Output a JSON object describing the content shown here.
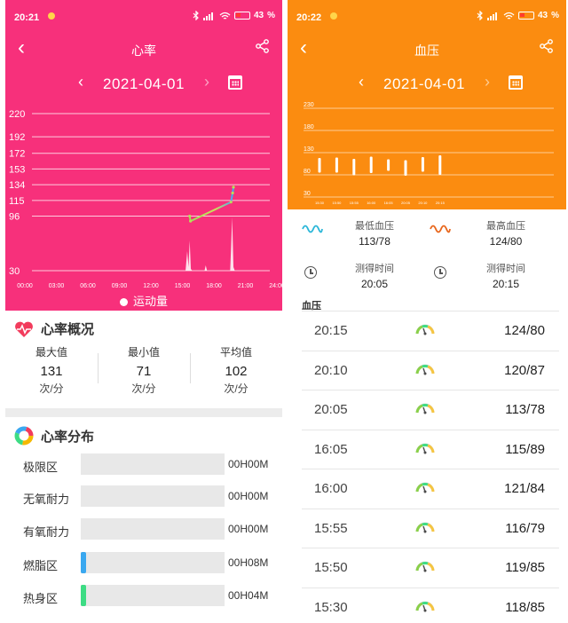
{
  "left": {
    "status": {
      "time": "20:21",
      "battery": "43"
    },
    "header": {
      "title": "心率",
      "date": "2021-04-01"
    },
    "colors": {
      "accent": "#f7307b"
    },
    "chart_data": {
      "type": "area",
      "y_ticks": [
        "220",
        "192",
        "172",
        "153",
        "134",
        "115",
        "96",
        "30"
      ],
      "x_ticks": [
        "00:00",
        "03:00",
        "06:00",
        "09:00",
        "12:00",
        "15:00",
        "18:00",
        "21:00",
        "24:00"
      ],
      "ylim": [
        30,
        220
      ],
      "legend": "运动量",
      "heart_rate_line": [
        {
          "x": "15:55",
          "y": 96
        },
        {
          "x": "16:00",
          "y": 90
        },
        {
          "x": "20:05",
          "y": 113
        },
        {
          "x": "20:15",
          "y": 124
        },
        {
          "x": "20:20",
          "y": 131
        }
      ]
    },
    "overview": {
      "title": "心率概况",
      "stats": [
        {
          "label": "最大值",
          "value": "131",
          "unit": "次/分"
        },
        {
          "label": "最小值",
          "value": "71",
          "unit": "次/分"
        },
        {
          "label": "平均值",
          "value": "102",
          "unit": "次/分"
        }
      ]
    },
    "zones": {
      "title": "心率分布",
      "items": [
        {
          "label": "极限区",
          "time": "00H00M",
          "color": ""
        },
        {
          "label": "无氧耐力",
          "time": "00H00M",
          "color": ""
        },
        {
          "label": "有氧耐力",
          "time": "00H00M",
          "color": ""
        },
        {
          "label": "燃脂区",
          "time": "00H08M",
          "color": "#3aa8f0"
        },
        {
          "label": "热身区",
          "time": "00H04M",
          "color": "#3ddc84"
        }
      ]
    }
  },
  "right": {
    "status": {
      "time": "20:22",
      "battery": "43"
    },
    "header": {
      "title": "血压",
      "date": "2021-04-01"
    },
    "colors": {
      "accent": "#fb8c10"
    },
    "chart_data": {
      "type": "bar",
      "y_ticks": [
        "230",
        "180",
        "130",
        "80",
        "30"
      ],
      "ylim": [
        30,
        230
      ],
      "categories": [
        "15:30",
        "15:50",
        "15:55",
        "16:00",
        "16:05",
        "20:05",
        "20:10",
        "20:15"
      ],
      "series": [
        {
          "name": "",
          "low": [
            85,
            85,
            79,
            84,
            89,
            78,
            87,
            80
          ],
          "high": [
            118,
            119,
            116,
            121,
            115,
            113,
            120,
            124
          ]
        }
      ]
    },
    "summary": {
      "low_label": "最低血压",
      "low_value": "113/78",
      "high_label": "最高血压",
      "high_value": "124/80",
      "time_label_1": "测得时间",
      "time_value_1": "20:05",
      "time_label_2": "测得时间",
      "time_value_2": "20:15"
    },
    "list_title": "血压",
    "records": [
      {
        "time": "20:15",
        "value": "124/80"
      },
      {
        "time": "20:10",
        "value": "120/87"
      },
      {
        "time": "20:05",
        "value": "113/78"
      },
      {
        "time": "16:05",
        "value": "115/89"
      },
      {
        "time": "16:00",
        "value": "121/84"
      },
      {
        "time": "15:55",
        "value": "116/79"
      },
      {
        "time": "15:50",
        "value": "119/85"
      },
      {
        "time": "15:30",
        "value": "118/85"
      }
    ]
  }
}
